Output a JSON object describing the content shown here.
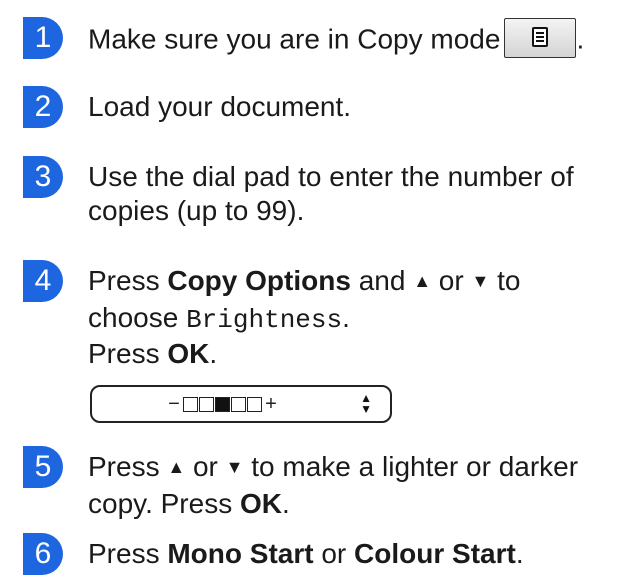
{
  "steps": [
    {
      "num": "1",
      "text": "Make sure you are in Copy mode",
      "tail": "."
    },
    {
      "num": "2",
      "text": "Load your document."
    },
    {
      "num": "3",
      "line1": "Use the dial pad to enter the number of",
      "line2": "copies (up to 99)."
    },
    {
      "num": "4",
      "press": "Press",
      "bold1": "Copy Options",
      "and_up": "and",
      "up": "▲",
      "or": "or",
      "down": "▼",
      "to": "to",
      "choose": "choose",
      "setting": "Brightness",
      "dot": ".",
      "press2": "Press",
      "ok": "OK",
      "dot2": "."
    },
    {
      "num": "5",
      "press": "Press",
      "up": "▲",
      "or": "or",
      "down": "▼",
      "rest": "to make a lighter or darker",
      "line2a": "copy. Press",
      "ok": "OK",
      "dot": "."
    },
    {
      "num": "6",
      "press": "Press",
      "bold1": "Mono Start",
      "or": "or",
      "bold2": "Colour Start",
      "dot": "."
    }
  ],
  "lcd": {
    "minus": "−",
    "plus": "+",
    "level": 3,
    "levels_total": 5,
    "updown_icon": "up-down-arrows-icon"
  },
  "copy_mode_icon": "copy-document-icon",
  "colors": {
    "badge": "#1e66e0"
  }
}
